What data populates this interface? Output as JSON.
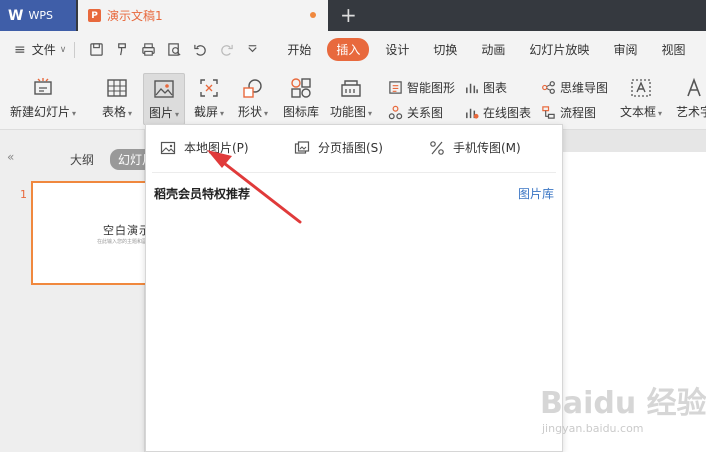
{
  "app": {
    "logo": "W",
    "name": "WPS",
    "brand_color": "#3f5ea8"
  },
  "document": {
    "tab_icon": "P",
    "title": "演示文稿1",
    "accent": "#e8693d"
  },
  "new_tab": "+",
  "menubar": {
    "menu_icon": "≡",
    "file_label": "文件",
    "tabs": [
      {
        "label": "开始",
        "active": false
      },
      {
        "label": "插入",
        "active": true
      },
      {
        "label": "设计",
        "active": false
      },
      {
        "label": "切换",
        "active": false
      },
      {
        "label": "动画",
        "active": false
      },
      {
        "label": "幻灯片放映",
        "active": false
      },
      {
        "label": "审阅",
        "active": false
      },
      {
        "label": "视图",
        "active": false
      }
    ]
  },
  "ribbon": {
    "new_slide": "新建幻灯片",
    "table": "表格",
    "picture": "图片",
    "screenshot": "截屏",
    "shape": "形状",
    "icon_lib": "图标库",
    "func_chart": "功能图",
    "smart_shape": "智能图形",
    "chart": "图表",
    "mindmap": "思维导图",
    "relation": "关系图",
    "online_chart": "在线图表",
    "flowchart": "流程图",
    "textbox": "文本框",
    "art_text": "艺术字"
  },
  "left_panel": {
    "collapse": "«",
    "outline_tab": "大纲",
    "slides_tab": "幻灯片",
    "slide_number": "1",
    "thumb_title": "空白演示",
    "thumb_subtitle": "在此输入您的主题和副标题"
  },
  "dropdown": {
    "local_picture": "本地图片(P)",
    "page_insert": "分页插图(S)",
    "phone_picture": "手机传图(M)",
    "promo": "稻壳会员特权推荐",
    "gallery": "图片库"
  },
  "watermark": {
    "text": "Baidu 经验",
    "url": "jingyan.baidu.com"
  }
}
